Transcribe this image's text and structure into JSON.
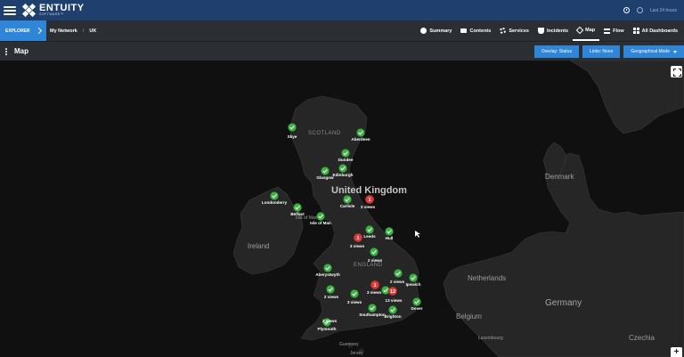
{
  "app": {
    "logo_name": "ENTUITY",
    "logo_sub": "SOFTWARE™",
    "user_text": "Last 24 hours"
  },
  "nav": {
    "explorer_label": "EXPLORER",
    "breadcrumb": [
      "My Network",
      "/",
      "UK"
    ],
    "tabs": [
      {
        "label": "Summary",
        "icon": "info-icon"
      },
      {
        "label": "Contents",
        "icon": "folder-icon"
      },
      {
        "label": "Services",
        "icon": "gear-icon"
      },
      {
        "label": "Incidents",
        "icon": "shield-icon"
      },
      {
        "label": "Map",
        "icon": "map-icon",
        "active": true
      },
      {
        "label": "Flow",
        "icon": "flow-icon"
      },
      {
        "label": "All Dashboards",
        "icon": "grid-icon"
      }
    ]
  },
  "toolbar": {
    "title": "Map",
    "overlay_label": "Overlay: Status",
    "links_label": "Links: None",
    "mode_label": "Geographical Mode"
  },
  "map": {
    "regions": [
      "SCOTLAND",
      "ENGLAND"
    ],
    "countries": [
      "United Kingdom",
      "Ireland",
      "Isle of Man",
      "Denmark",
      "Netherlands",
      "Belgium",
      "Germany",
      "Luxembourg",
      "Czechia",
      "Guernsey",
      "Jersey"
    ],
    "sites": [
      {
        "name": "Skye",
        "status": "ok"
      },
      {
        "name": "Aberdeen",
        "status": "ok"
      },
      {
        "name": "Dundee",
        "status": "ok"
      },
      {
        "name": "Glasgow",
        "status": "ok"
      },
      {
        "name": "Edinburgh",
        "status": "ok"
      },
      {
        "name": "Londonderry",
        "status": "ok"
      },
      {
        "name": "Belfast",
        "status": "ok"
      },
      {
        "name": "Carlisle",
        "status": "ok"
      },
      {
        "name": "Isle of Man",
        "status": "ok"
      },
      {
        "name": "Leeds",
        "status": "ok"
      },
      {
        "name": "Hull",
        "status": "ok"
      },
      {
        "name": "Aberystwyth",
        "status": "ok"
      },
      {
        "name": "Ipswich",
        "status": "ok"
      },
      {
        "name": "Southampton",
        "status": "ok"
      },
      {
        "name": "Brighton",
        "status": "ok"
      },
      {
        "name": "Dover",
        "status": "ok"
      },
      {
        "name": "Plymouth",
        "status": "ok"
      }
    ],
    "view_labels": [
      "3 views",
      "3 views",
      "2 views",
      "2 views",
      "3 views",
      "2 views",
      "3 views",
      "13 views",
      "2 views"
    ],
    "badges": [
      "1",
      "1",
      "1",
      "12"
    ],
    "colors": {
      "ok": "#3cb043",
      "alert": "#d93a3a",
      "land": "#262626",
      "sea": "#101010",
      "accent": "#2f86d8"
    }
  }
}
